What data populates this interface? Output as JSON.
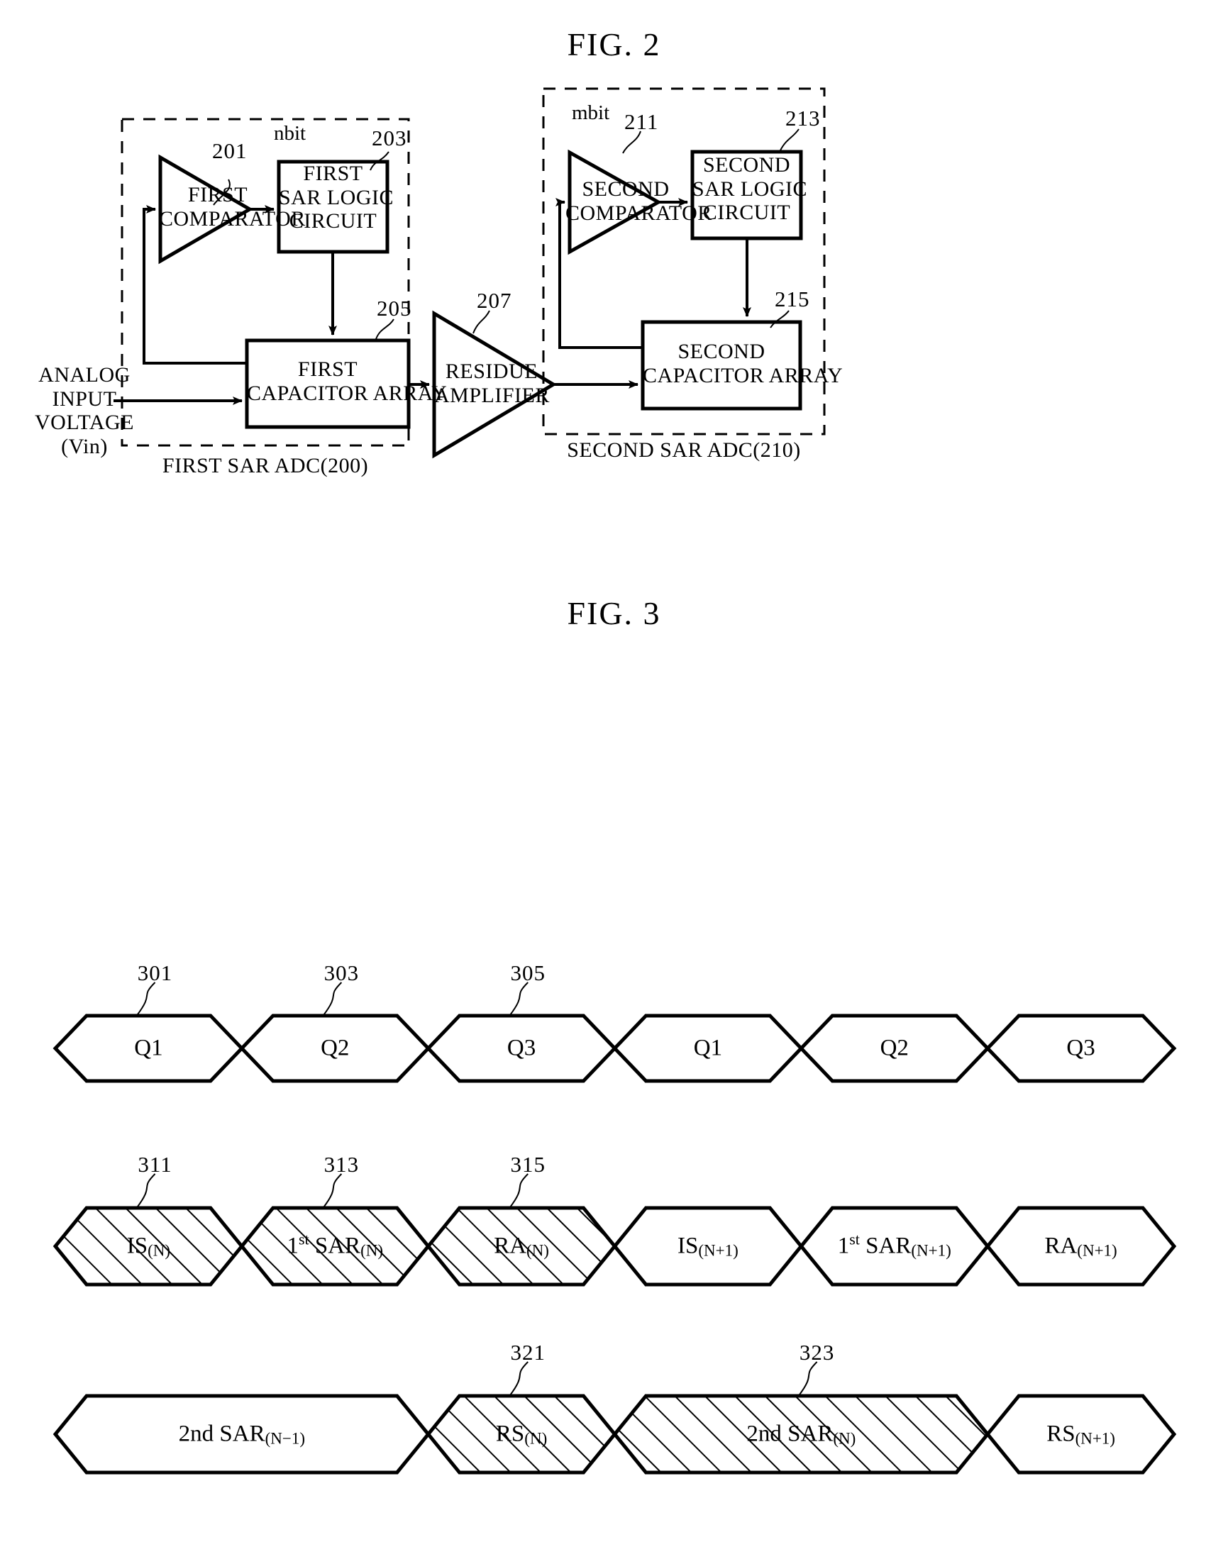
{
  "figures": [
    {
      "id": "fig2",
      "title": "FIG. 2"
    },
    {
      "id": "fig3",
      "title": "FIG. 3"
    }
  ],
  "fig2": {
    "title": "FIG. 2",
    "input_label": "ANALOG\nINPUT\nVOLTAGE\n(Vin)",
    "input_lines": [
      "ANALOG",
      "INPUT",
      "VOLTAGE",
      "(Vin)"
    ],
    "first_adc": {
      "caption": "FIRST SAR ADC(200)",
      "bit_label": "nbit",
      "blocks": [
        {
          "ref": "201",
          "lines": [
            "FIRST",
            "COMPARATOR"
          ],
          "shape": "triangle"
        },
        {
          "ref": "203",
          "lines": [
            "FIRST",
            "SAR LOGIC",
            "CIRCUIT"
          ],
          "shape": "rect"
        },
        {
          "ref": "205",
          "lines": [
            "FIRST",
            "CAPACITOR ARRAY"
          ],
          "shape": "rect"
        }
      ]
    },
    "residue_amplifier": {
      "ref": "207",
      "lines": [
        "RESIDUE",
        "AMPLIFIER"
      ],
      "shape": "triangle"
    },
    "second_adc": {
      "caption": "SECOND SAR ADC(210)",
      "bit_label": "mbit",
      "blocks": [
        {
          "ref": "211",
          "lines": [
            "SECOND",
            "COMPARATOR"
          ],
          "shape": "triangle"
        },
        {
          "ref": "213",
          "lines": [
            "SECOND",
            "SAR LOGIC",
            "CIRCUIT"
          ],
          "shape": "rect"
        },
        {
          "ref": "215",
          "lines": [
            "SECOND",
            "CAPACITOR ARRAY"
          ],
          "shape": "rect"
        }
      ]
    }
  },
  "fig3": {
    "title": "FIG. 3",
    "rows": [
      {
        "name": "clock-phase-row",
        "refs": [
          {
            "text": "301",
            "cell": 0
          },
          {
            "text": "303",
            "cell": 1
          },
          {
            "text": "305",
            "cell": 2
          }
        ],
        "cells": [
          {
            "label": "Q1",
            "hatched": false
          },
          {
            "label": "Q2",
            "hatched": false
          },
          {
            "label": "Q3",
            "hatched": false
          },
          {
            "label": "Q1",
            "hatched": false
          },
          {
            "label": "Q2",
            "hatched": false
          },
          {
            "label": "Q3",
            "hatched": false
          }
        ]
      },
      {
        "name": "first-stage-row",
        "refs": [
          {
            "text": "311",
            "cell": 0
          },
          {
            "text": "313",
            "cell": 1
          },
          {
            "text": "315",
            "cell": 2
          }
        ],
        "cells": [
          {
            "label": "IS",
            "sub": "(N)",
            "hatched": true
          },
          {
            "label": "1st SAR",
            "sup_in_label": "st",
            "sub": "(N)",
            "hatched": true
          },
          {
            "label": "RA",
            "sub": "(N)",
            "hatched": true
          },
          {
            "label": "IS",
            "sub": "(N+1)",
            "hatched": false
          },
          {
            "label": "1st SAR",
            "sup_in_label": "st",
            "sub": "(N+1)",
            "hatched": false
          },
          {
            "label": "RA",
            "sub": "(N+1)",
            "hatched": false
          }
        ]
      },
      {
        "name": "second-stage-row",
        "refs": [
          {
            "text": "321",
            "cell": 1
          },
          {
            "text": "323",
            "cell": 2
          }
        ],
        "cells": [
          {
            "label": "2nd SAR",
            "sub": "(N−1)",
            "hatched": false,
            "span": 2
          },
          {
            "label": "RS",
            "sub": "(N)",
            "hatched": true,
            "span": 1
          },
          {
            "label": "2nd SAR",
            "sub": "(N)",
            "hatched": true,
            "span": 2
          },
          {
            "label": "RS",
            "sub": "(N+1)",
            "hatched": false,
            "span": 1
          }
        ]
      }
    ]
  },
  "colors": {
    "ink": "#000000",
    "paper": "#ffffff"
  }
}
